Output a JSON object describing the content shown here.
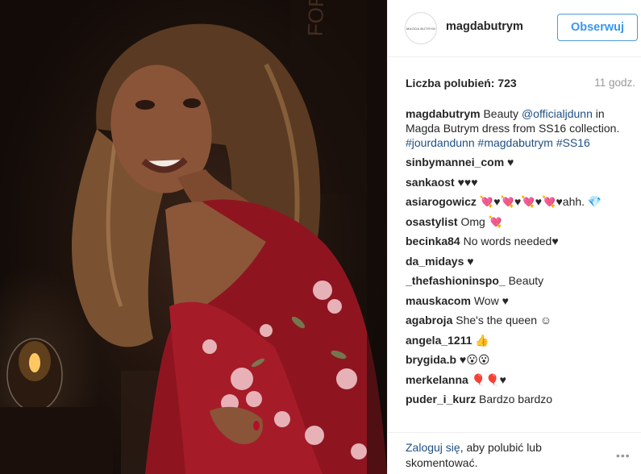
{
  "post": {
    "photo_alt": "woman in red floral dress smiling over her shoulder",
    "avatar_text": "MAGDA BUTRYM",
    "username": "magdabutrym",
    "follow_label": "Obserwuj",
    "likes": "Liczba polubień: 723",
    "time": "11 godz.",
    "caption": {
      "user": "magdabutrym",
      "text_1": " Beauty ",
      "mention": "@officialjdunn",
      "text_2": " in Magda Butrym dress from SS16 collection. ",
      "tag_1": "#jourdandunn",
      "text_3": " ",
      "tag_2": "#magdabutrym",
      "text_4": " ",
      "tag_3": "#SS16"
    },
    "comments": [
      {
        "user": "sinbymannei_com",
        "text": " ♥"
      },
      {
        "user": "sankaost",
        "text": " ♥♥♥"
      },
      {
        "user": "asiarogowicz",
        "text": " 💘♥💘♥💘♥💘♥ahh. 💎"
      },
      {
        "user": "osastylist",
        "text": " Omg 💘"
      },
      {
        "user": "becinka84",
        "text": " No words needed♥"
      },
      {
        "user": "da_midays",
        "text": " ♥"
      },
      {
        "user": "_thefashioninspo_",
        "text": " Beauty"
      },
      {
        "user": "mauskacom",
        "text": " Wow ♥"
      },
      {
        "user": "agabroja",
        "text": " She's the queen ☺"
      },
      {
        "user": "angela_1211",
        "text": " 👍"
      },
      {
        "user": "brygida.b",
        "text": " ♥😮😮"
      },
      {
        "user": "merkelanna",
        "text": " 🎈🎈♥"
      },
      {
        "user": "puder_i_kurz",
        "text": " Bardzo bardzo"
      }
    ],
    "login_link": "Zaloguj się",
    "login_rest": ", aby polubić lub skomentować.",
    "more_label": "•••"
  },
  "colors": {
    "follow_text": "#3897f0",
    "link": "#1f4f85",
    "muted": "#999999",
    "dress_red": "#8e1520"
  }
}
